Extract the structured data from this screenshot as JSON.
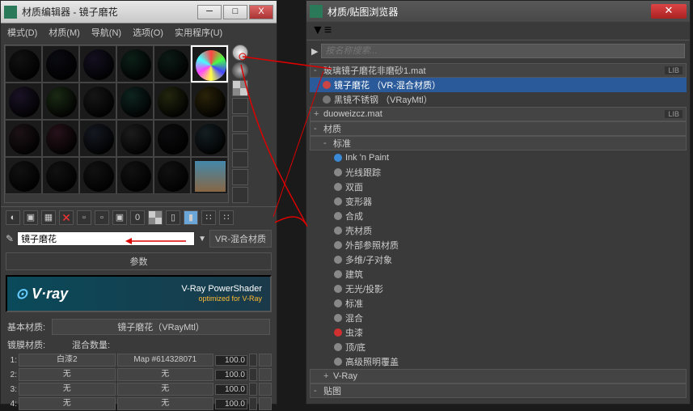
{
  "win1": {
    "title": "材质编辑器 - 镜子磨花",
    "menu": [
      "模式(D)",
      "材质(M)",
      "导航(N)",
      "选项(O)",
      "实用程序(U)"
    ],
    "swatch_colors": [
      "#111",
      "#0a0a12",
      "#141020",
      "#0c2018",
      "#0d1b16",
      "mosaic",
      "#1a1226",
      "#1a2a14",
      "#161616",
      "#0e2420",
      "#23260e",
      "#2a2309",
      "#1c1216",
      "#26121a",
      "#141820",
      "#1c1c1c",
      "#0c0c0e",
      "#141e22",
      "#111",
      "#111",
      "#111",
      "#111",
      "#111",
      "photo"
    ],
    "selected_index": 5,
    "name_field": "镜子磨花",
    "type_label": "VR-混合材质",
    "params_header": "参数",
    "vray_logo_text": "V·ray",
    "vray_ps": "V-Ray PowerShader",
    "vray_sub": "optimized for V-Ray",
    "base_label": "基本材质:",
    "base_value": "镜子磨花（VRayMtl）",
    "coat_label": "镀膜材质:",
    "mix_label": "混合数量:",
    "rows": [
      {
        "n": "1:",
        "a": "白漆2",
        "b": "Map #614328071",
        "v": "100.0"
      },
      {
        "n": "2:",
        "a": "无",
        "b": "无",
        "v": "100.0"
      },
      {
        "n": "3:",
        "a": "无",
        "b": "无",
        "v": "100.0"
      },
      {
        "n": "4:",
        "a": "无",
        "b": "无",
        "v": "100.0"
      }
    ]
  },
  "win2": {
    "title": "材质/贴图浏览器",
    "search_placeholder": "按名称搜索...",
    "group1": {
      "label": "玻璃镜子磨花非磨砂1.mat",
      "tag": "LIB"
    },
    "items1": [
      {
        "label": "镜子磨花 （VR-混合材质）",
        "sel": true,
        "color": "#c44"
      },
      {
        "label": "黑镜不锈钢 （VRayMtl）",
        "sel": false,
        "color": "#777"
      }
    ],
    "group2": {
      "label": "duoweizcz.mat",
      "tag": "LIB"
    },
    "group3": "材质",
    "group4": "标准",
    "std_items": [
      "Ink 'n Paint",
      "光线跟踪",
      "双面",
      "变形器",
      "合成",
      "壳材质",
      "外部参照材质",
      "多维/子对象",
      "建筑",
      "无光/投影",
      "标准",
      "混合",
      "虫漆",
      "顶/底",
      "高级照明覆盖"
    ],
    "std_colors": {
      "0": "#3a8ad8",
      "12": "#d03030"
    },
    "group5": "V-Ray",
    "group6": "贴图"
  }
}
